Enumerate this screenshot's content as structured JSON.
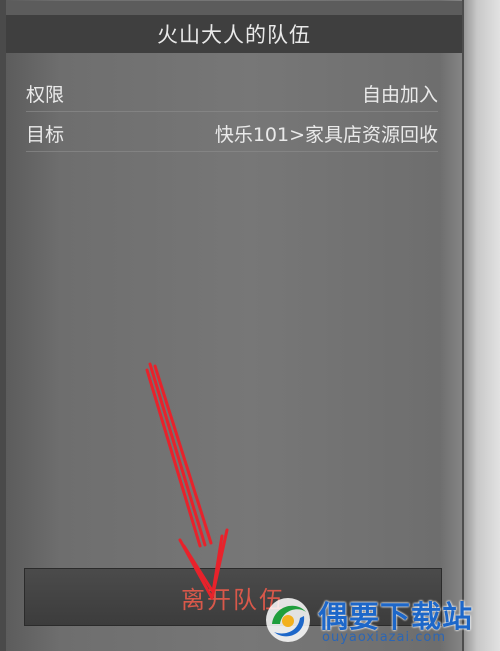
{
  "team_panel": {
    "title": "火山大人的队伍",
    "rows": [
      {
        "label": "权限",
        "value": "自由加入"
      },
      {
        "label": "目标",
        "value": "快乐101>家具店资源回收"
      }
    ],
    "leave_button_label": "离开队伍"
  },
  "watermark": {
    "brand": "偶要下载站",
    "url": "ouyaoxiazai.com"
  },
  "colors": {
    "panel_bg": "#6b6b6b",
    "title_bar": "#3f3f3f",
    "text": "#eaeaea",
    "leave_text": "#d9584a",
    "arrow": "#e8222b",
    "watermark_blue": "#1d67c9"
  }
}
